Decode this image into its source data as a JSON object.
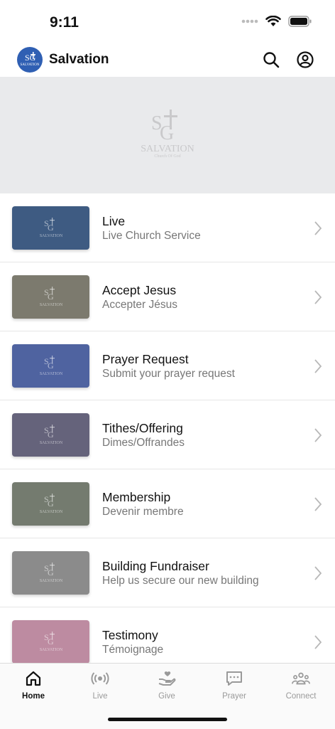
{
  "status_bar": {
    "time": "9:11"
  },
  "header": {
    "title": "Salvation",
    "logo_text": "SALVATION",
    "search_icon": "search-icon",
    "account_icon": "account-icon"
  },
  "hero": {
    "logo_wordmark": "SALVATION",
    "logo_subtitle": "Church Of God"
  },
  "menu": [
    {
      "title": "Live",
      "subtitle": "Live Church Service",
      "color": "#3e5b82"
    },
    {
      "title": "Accept Jesus",
      "subtitle": "Accepter Jésus",
      "color": "#7c7a6e"
    },
    {
      "title": "Prayer Request",
      "subtitle": "Submit your prayer request",
      "color": "#4f63a0"
    },
    {
      "title": "Tithes/Offering",
      "subtitle": "Dimes/Offrandes",
      "color": "#65637b"
    },
    {
      "title": "Membership",
      "subtitle": "Devenir membre",
      "color": "#747b6f"
    },
    {
      "title": "Building Fundraiser",
      "subtitle": "Help us secure our new building",
      "color": "#8b8b8b"
    },
    {
      "title": "Testimony",
      "subtitle": "Témoignage",
      "color": "#bd8ba1"
    }
  ],
  "thumb_logo_text": "SALVATION",
  "tabs": [
    {
      "label": "Home",
      "icon": "home-icon",
      "active": true
    },
    {
      "label": "Live",
      "icon": "broadcast-icon",
      "active": false
    },
    {
      "label": "Give",
      "icon": "give-icon",
      "active": false
    },
    {
      "label": "Prayer",
      "icon": "chat-icon",
      "active": false
    },
    {
      "label": "Connect",
      "icon": "people-icon",
      "active": false
    }
  ]
}
